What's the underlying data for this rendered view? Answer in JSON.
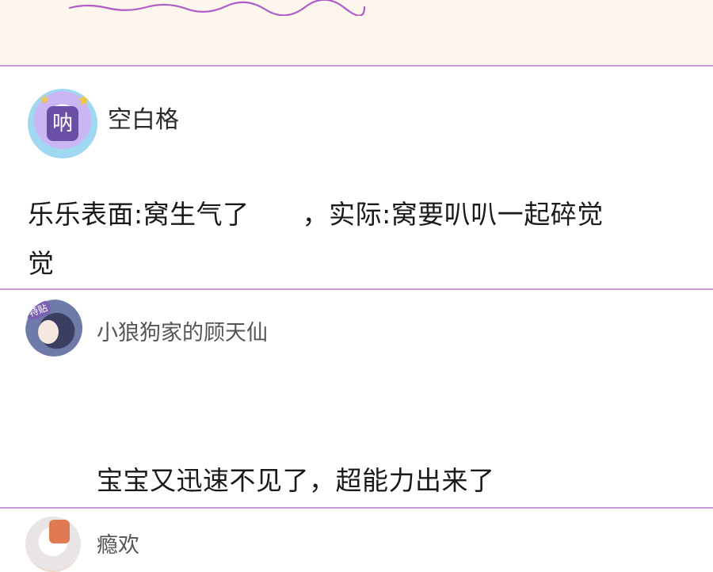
{
  "comments": [
    {
      "username": "空白格",
      "badge_text": "呐",
      "text_line1": "乐乐表面:窝生气了　　，实际:窝要叭叭一起碎觉",
      "text_line2": "觉"
    },
    {
      "username": "小狼狗家的顾天仙",
      "badge_text": "特贴",
      "text_line1": "宝宝又迅速不见了，超能力出来了"
    },
    {
      "username": "瘾欢"
    }
  ],
  "colors": {
    "divider": "#c89ad8",
    "top_band": "#fcf6ec",
    "squiggle": "#b05cc8"
  }
}
